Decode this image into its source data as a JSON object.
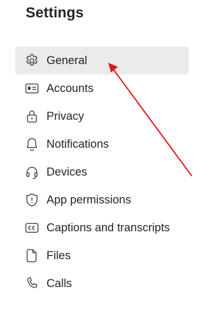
{
  "page": {
    "title": "Settings"
  },
  "menu": {
    "items": [
      {
        "label": "General",
        "icon": "gear-icon",
        "selected": true
      },
      {
        "label": "Accounts",
        "icon": "id-card-icon",
        "selected": false
      },
      {
        "label": "Privacy",
        "icon": "lock-icon",
        "selected": false
      },
      {
        "label": "Notifications",
        "icon": "bell-icon",
        "selected": false
      },
      {
        "label": "Devices",
        "icon": "headset-icon",
        "selected": false
      },
      {
        "label": "App permissions",
        "icon": "shield-icon",
        "selected": false
      },
      {
        "label": "Captions and transcripts",
        "icon": "closed-captions-icon",
        "selected": false
      },
      {
        "label": "Files",
        "icon": "file-icon",
        "selected": false
      },
      {
        "label": "Calls",
        "icon": "phone-icon",
        "selected": false
      }
    ]
  },
  "colors": {
    "selected_background": "#ebebeb",
    "annotation_arrow": "#e3141b"
  }
}
